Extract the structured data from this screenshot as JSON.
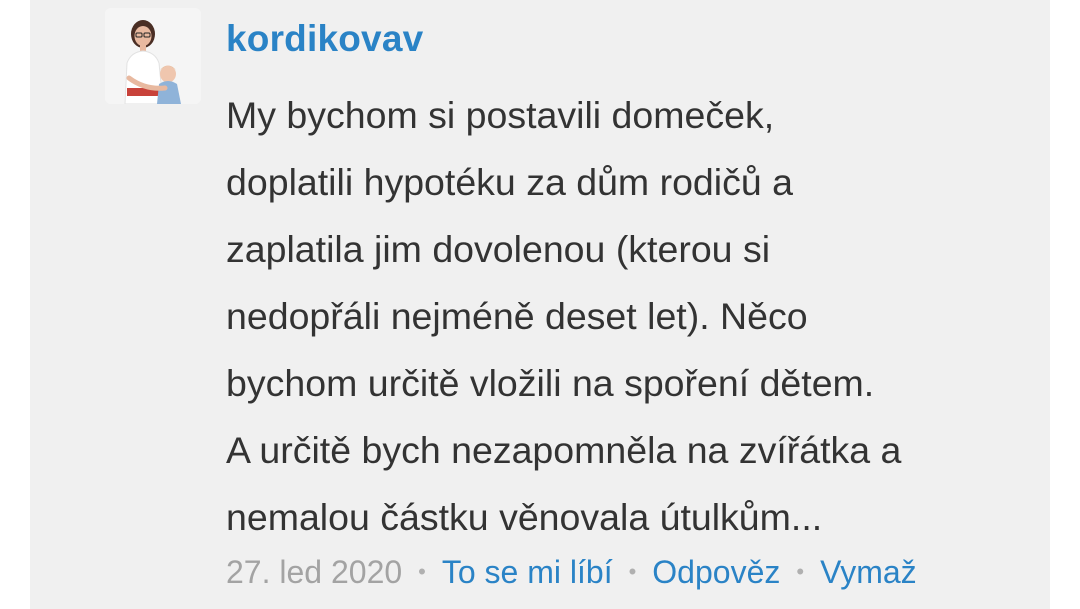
{
  "comment": {
    "username": "kordikovav",
    "avatar_icon": "user-photo-avatar",
    "text_lines": [
      "My bychom si postavili domeček,",
      "doplatili hypotéku za dům rodičů a",
      "zaplatila jim dovolenou (kterou si",
      "nedopřáli nejméně deset let). Něco",
      "bychom určitě vložili na spoření dětem.",
      "A určitě bych nezapomněla na zvířátka a",
      "nemalou částku věnovala útulkům..."
    ],
    "date": "27. led 2020",
    "separator": "•",
    "actions": {
      "like": "To se mi líbí",
      "reply": "Odpověz",
      "delete": "Vymaž"
    }
  },
  "colors": {
    "accent": "#2a83c6",
    "text": "#333333",
    "muted": "#a3a3a3",
    "card_background": "#f0f0f0"
  }
}
